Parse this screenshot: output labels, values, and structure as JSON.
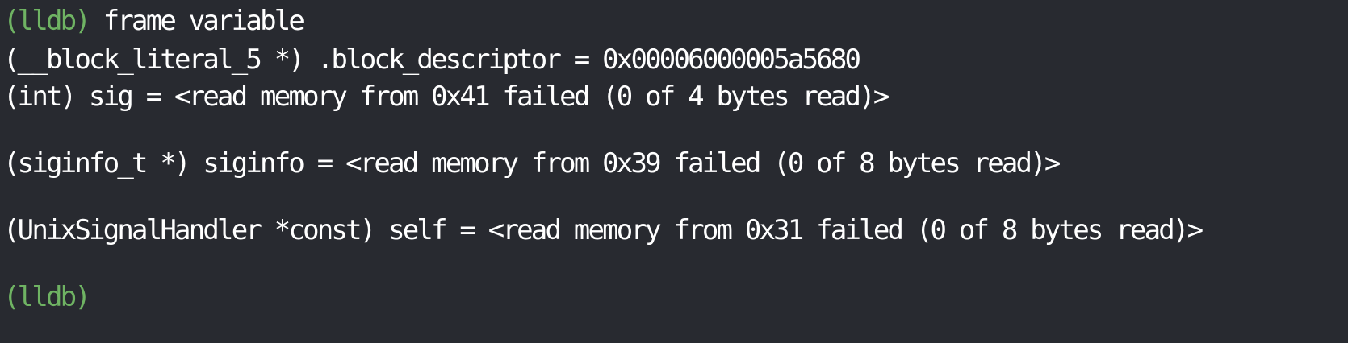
{
  "terminal": {
    "prompt": "(lldb)",
    "command": " frame variable",
    "output": [
      "(__block_literal_5 *) .block_descriptor = 0x00006000005a5680",
      "(int) sig = <read memory from 0x41 failed (0 of 4 bytes read)>",
      "(siginfo_t *) siginfo = <read memory from 0x39 failed (0 of 8 bytes read)>",
      "(UnixSignalHandler *const) self = <read memory from 0x31 failed (0 of 8 bytes read)>"
    ],
    "final_prompt": "(lldb)"
  },
  "colors": {
    "background": "#282a30",
    "text": "#ffffff",
    "prompt": "#6fb363"
  }
}
